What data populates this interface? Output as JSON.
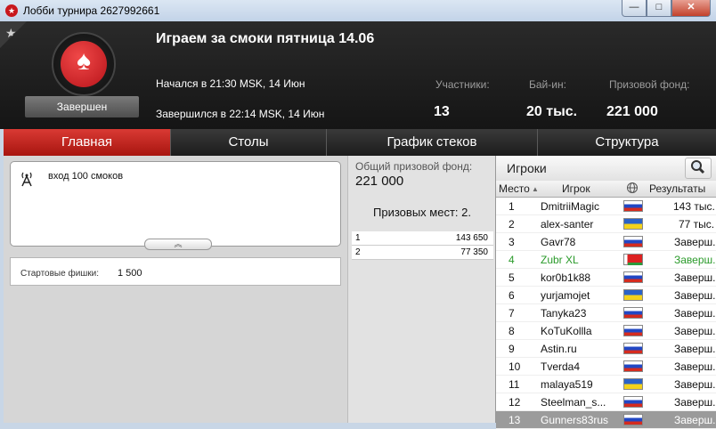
{
  "window": {
    "title": "Лобби турнира 2627992661",
    "controls": {
      "minimize": "—",
      "maximize": "□",
      "close": "✕"
    }
  },
  "header": {
    "tournament_name": "Играем за смоки пятница 14.06",
    "status": "Завершен",
    "started": "Начался в 21:30 MSK, 14 Июн",
    "ended": "Завершился в 22:14 MSK, 14 Июн",
    "participants_label": "Участники:",
    "participants_value": "13",
    "buyin_label": "Бай-ин:",
    "buyin_value": "20 тыс.",
    "prizepool_label": "Призовой фонд:",
    "prizepool_value": "221 000"
  },
  "tabs": [
    {
      "label": "Главная"
    },
    {
      "label": "Столы"
    },
    {
      "label": "График стеков"
    },
    {
      "label": "Структура"
    }
  ],
  "left": {
    "news_message": "вход 100 смоков",
    "starting_chips_label": "Стартовые фишки:",
    "starting_chips_value": "1 500"
  },
  "middle": {
    "total_prize_label": "Общий призовой фонд:",
    "total_prize_value": "221 000",
    "prize_places": "Призовых мест: 2.",
    "payouts": [
      {
        "place": "1",
        "amount": "143 650"
      },
      {
        "place": "2",
        "amount": "77 350"
      }
    ]
  },
  "players": {
    "title": "Игроки",
    "columns": {
      "place": "Место",
      "player": "Игрок",
      "results": "Результаты"
    },
    "rows": [
      {
        "place": "1",
        "nick": "DmitriiMagic",
        "flag": "ru",
        "result": "143 тыс."
      },
      {
        "place": "2",
        "nick": "alex-santer",
        "flag": "ua",
        "result": "77 тыс."
      },
      {
        "place": "3",
        "nick": "Gavr78",
        "flag": "ru",
        "result": "Заверш."
      },
      {
        "place": "4",
        "nick": "Zubr XL",
        "flag": "by",
        "result": "Заверш."
      },
      {
        "place": "5",
        "nick": "kor0b1k88",
        "flag": "ru",
        "result": "Заверш."
      },
      {
        "place": "6",
        "nick": "yurjamojet",
        "flag": "ua",
        "result": "Заверш."
      },
      {
        "place": "7",
        "nick": "Tanyka23",
        "flag": "ru",
        "result": "Заверш."
      },
      {
        "place": "8",
        "nick": "KoTuKollla",
        "flag": "ru",
        "result": "Заверш."
      },
      {
        "place": "9",
        "nick": "Astin.ru",
        "flag": "ru",
        "result": "Заверш."
      },
      {
        "place": "10",
        "nick": "Tverda4",
        "flag": "ru",
        "result": "Заверш."
      },
      {
        "place": "11",
        "nick": "malaya519",
        "flag": "ua",
        "result": "Заверш."
      },
      {
        "place": "12",
        "nick": "Steelman_s...",
        "flag": "ru",
        "result": "Заверш."
      },
      {
        "place": "13",
        "nick": "Gunners83rus",
        "flag": "ru",
        "result": "Заверш."
      }
    ]
  },
  "colors": {
    "accent": "#c8171c",
    "header_bg": "#1c1c1c",
    "highlight_green": "#2a9a2a",
    "selected_row": "#9b9b9b"
  }
}
